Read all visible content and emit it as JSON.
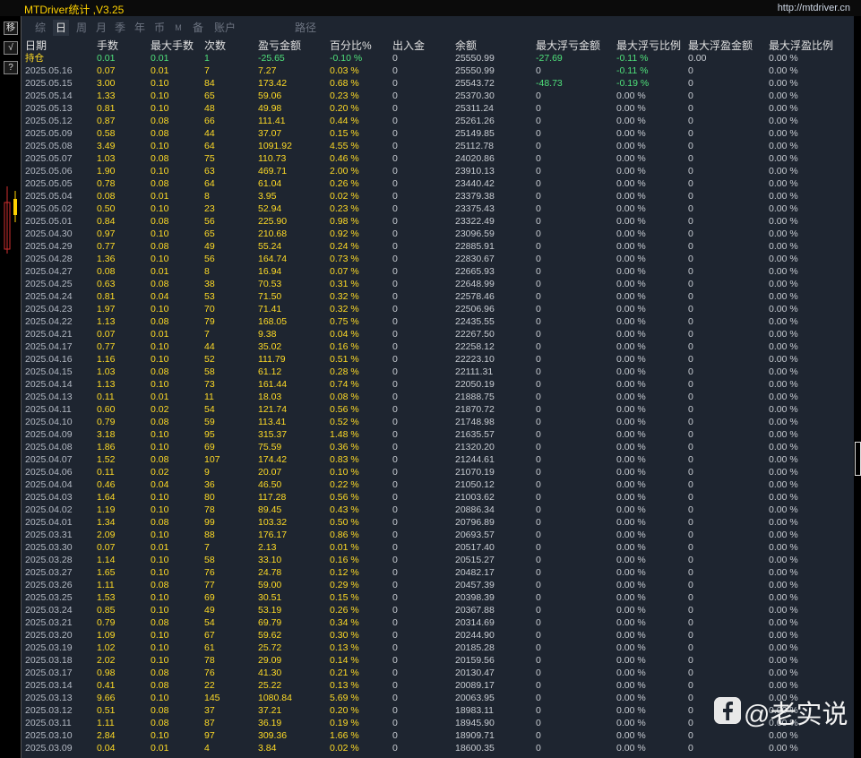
{
  "window": {
    "title": "MTDriver统计 ,V3.25",
    "link": "http://mtdriver.cn"
  },
  "side_toolbar": [
    "移",
    "√",
    "?"
  ],
  "tabs": [
    "综",
    "日",
    "周",
    "月",
    "季",
    "年",
    "币",
    "M",
    "备",
    "账户",
    "路径"
  ],
  "active_tab": "日",
  "table": {
    "headers": [
      "日期",
      "手数",
      "最大手数",
      "次数",
      "盈亏金额",
      "百分比%",
      "出入金",
      "余额",
      "最大浮亏金额",
      "最大浮亏比例",
      "最大浮盈金额",
      "最大浮盈比例"
    ],
    "rows": [
      [
        "持仓",
        "0.01",
        "0.01",
        "1",
        "-25.65",
        "-0.10 %",
        "0",
        "25550.99",
        "-27.69",
        "-0.11 %",
        "0.00",
        "0.00 %"
      ],
      [
        "2025.05.16",
        "0.07",
        "0.01",
        "7",
        "7.27",
        "0.03 %",
        "0",
        "25550.99",
        "0",
        "-0.11 %",
        "0",
        "0.00 %"
      ],
      [
        "2025.05.15",
        "3.00",
        "0.10",
        "84",
        "173.42",
        "0.68 %",
        "0",
        "25543.72",
        "-48.73",
        "-0.19 %",
        "0",
        "0.00 %"
      ],
      [
        "2025.05.14",
        "1.33",
        "0.10",
        "65",
        "59.06",
        "0.23 %",
        "0",
        "25370.30",
        "0",
        "0.00 %",
        "0",
        "0.00 %"
      ],
      [
        "2025.05.13",
        "0.81",
        "0.10",
        "48",
        "49.98",
        "0.20 %",
        "0",
        "25311.24",
        "0",
        "0.00 %",
        "0",
        "0.00 %"
      ],
      [
        "2025.05.12",
        "0.87",
        "0.08",
        "66",
        "111.41",
        "0.44 %",
        "0",
        "25261.26",
        "0",
        "0.00 %",
        "0",
        "0.00 %"
      ],
      [
        "2025.05.09",
        "0.58",
        "0.08",
        "44",
        "37.07",
        "0.15 %",
        "0",
        "25149.85",
        "0",
        "0.00 %",
        "0",
        "0.00 %"
      ],
      [
        "2025.05.08",
        "3.49",
        "0.10",
        "64",
        "1091.92",
        "4.55 %",
        "0",
        "25112.78",
        "0",
        "0.00 %",
        "0",
        "0.00 %"
      ],
      [
        "2025.05.07",
        "1.03",
        "0.08",
        "75",
        "110.73",
        "0.46 %",
        "0",
        "24020.86",
        "0",
        "0.00 %",
        "0",
        "0.00 %"
      ],
      [
        "2025.05.06",
        "1.90",
        "0.10",
        "63",
        "469.71",
        "2.00 %",
        "0",
        "23910.13",
        "0",
        "0.00 %",
        "0",
        "0.00 %"
      ],
      [
        "2025.05.05",
        "0.78",
        "0.08",
        "64",
        "61.04",
        "0.26 %",
        "0",
        "23440.42",
        "0",
        "0.00 %",
        "0",
        "0.00 %"
      ],
      [
        "2025.05.04",
        "0.08",
        "0.01",
        "8",
        "3.95",
        "0.02 %",
        "0",
        "23379.38",
        "0",
        "0.00 %",
        "0",
        "0.00 %"
      ],
      [
        "2025.05.02",
        "0.50",
        "0.10",
        "23",
        "52.94",
        "0.23 %",
        "0",
        "23375.43",
        "0",
        "0.00 %",
        "0",
        "0.00 %"
      ],
      [
        "2025.05.01",
        "0.84",
        "0.08",
        "56",
        "225.90",
        "0.98 %",
        "0",
        "23322.49",
        "0",
        "0.00 %",
        "0",
        "0.00 %"
      ],
      [
        "2025.04.30",
        "0.97",
        "0.10",
        "65",
        "210.68",
        "0.92 %",
        "0",
        "23096.59",
        "0",
        "0.00 %",
        "0",
        "0.00 %"
      ],
      [
        "2025.04.29",
        "0.77",
        "0.08",
        "49",
        "55.24",
        "0.24 %",
        "0",
        "22885.91",
        "0",
        "0.00 %",
        "0",
        "0.00 %"
      ],
      [
        "2025.04.28",
        "1.36",
        "0.10",
        "56",
        "164.74",
        "0.73 %",
        "0",
        "22830.67",
        "0",
        "0.00 %",
        "0",
        "0.00 %"
      ],
      [
        "2025.04.27",
        "0.08",
        "0.01",
        "8",
        "16.94",
        "0.07 %",
        "0",
        "22665.93",
        "0",
        "0.00 %",
        "0",
        "0.00 %"
      ],
      [
        "2025.04.25",
        "0.63",
        "0.08",
        "38",
        "70.53",
        "0.31 %",
        "0",
        "22648.99",
        "0",
        "0.00 %",
        "0",
        "0.00 %"
      ],
      [
        "2025.04.24",
        "0.81",
        "0.04",
        "53",
        "71.50",
        "0.32 %",
        "0",
        "22578.46",
        "0",
        "0.00 %",
        "0",
        "0.00 %"
      ],
      [
        "2025.04.23",
        "1.97",
        "0.10",
        "70",
        "71.41",
        "0.32 %",
        "0",
        "22506.96",
        "0",
        "0.00 %",
        "0",
        "0.00 %"
      ],
      [
        "2025.04.22",
        "1.13",
        "0.08",
        "79",
        "168.05",
        "0.75 %",
        "0",
        "22435.55",
        "0",
        "0.00 %",
        "0",
        "0.00 %"
      ],
      [
        "2025.04.21",
        "0.07",
        "0.01",
        "7",
        "9.38",
        "0.04 %",
        "0",
        "22267.50",
        "0",
        "0.00 %",
        "0",
        "0.00 %"
      ],
      [
        "2025.04.17",
        "0.77",
        "0.10",
        "44",
        "35.02",
        "0.16 %",
        "0",
        "22258.12",
        "0",
        "0.00 %",
        "0",
        "0.00 %"
      ],
      [
        "2025.04.16",
        "1.16",
        "0.10",
        "52",
        "111.79",
        "0.51 %",
        "0",
        "22223.10",
        "0",
        "0.00 %",
        "0",
        "0.00 %"
      ],
      [
        "2025.04.15",
        "1.03",
        "0.08",
        "58",
        "61.12",
        "0.28 %",
        "0",
        "22111.31",
        "0",
        "0.00 %",
        "0",
        "0.00 %"
      ],
      [
        "2025.04.14",
        "1.13",
        "0.10",
        "73",
        "161.44",
        "0.74 %",
        "0",
        "22050.19",
        "0",
        "0.00 %",
        "0",
        "0.00 %"
      ],
      [
        "2025.04.13",
        "0.11",
        "0.01",
        "11",
        "18.03",
        "0.08 %",
        "0",
        "21888.75",
        "0",
        "0.00 %",
        "0",
        "0.00 %"
      ],
      [
        "2025.04.11",
        "0.60",
        "0.02",
        "54",
        "121.74",
        "0.56 %",
        "0",
        "21870.72",
        "0",
        "0.00 %",
        "0",
        "0.00 %"
      ],
      [
        "2025.04.10",
        "0.79",
        "0.08",
        "59",
        "113.41",
        "0.52 %",
        "0",
        "21748.98",
        "0",
        "0.00 %",
        "0",
        "0.00 %"
      ],
      [
        "2025.04.09",
        "3.18",
        "0.10",
        "95",
        "315.37",
        "1.48 %",
        "0",
        "21635.57",
        "0",
        "0.00 %",
        "0",
        "0.00 %"
      ],
      [
        "2025.04.08",
        "1.86",
        "0.10",
        "69",
        "75.59",
        "0.36 %",
        "0",
        "21320.20",
        "0",
        "0.00 %",
        "0",
        "0.00 %"
      ],
      [
        "2025.04.07",
        "1.52",
        "0.08",
        "107",
        "174.42",
        "0.83 %",
        "0",
        "21244.61",
        "0",
        "0.00 %",
        "0",
        "0.00 %"
      ],
      [
        "2025.04.06",
        "0.11",
        "0.02",
        "9",
        "20.07",
        "0.10 %",
        "0",
        "21070.19",
        "0",
        "0.00 %",
        "0",
        "0.00 %"
      ],
      [
        "2025.04.04",
        "0.46",
        "0.04",
        "36",
        "46.50",
        "0.22 %",
        "0",
        "21050.12",
        "0",
        "0.00 %",
        "0",
        "0.00 %"
      ],
      [
        "2025.04.03",
        "1.64",
        "0.10",
        "80",
        "117.28",
        "0.56 %",
        "0",
        "21003.62",
        "0",
        "0.00 %",
        "0",
        "0.00 %"
      ],
      [
        "2025.04.02",
        "1.19",
        "0.10",
        "78",
        "89.45",
        "0.43 %",
        "0",
        "20886.34",
        "0",
        "0.00 %",
        "0",
        "0.00 %"
      ],
      [
        "2025.04.01",
        "1.34",
        "0.08",
        "99",
        "103.32",
        "0.50 %",
        "0",
        "20796.89",
        "0",
        "0.00 %",
        "0",
        "0.00 %"
      ],
      [
        "2025.03.31",
        "2.09",
        "0.10",
        "88",
        "176.17",
        "0.86 %",
        "0",
        "20693.57",
        "0",
        "0.00 %",
        "0",
        "0.00 %"
      ],
      [
        "2025.03.30",
        "0.07",
        "0.01",
        "7",
        "2.13",
        "0.01 %",
        "0",
        "20517.40",
        "0",
        "0.00 %",
        "0",
        "0.00 %"
      ],
      [
        "2025.03.28",
        "1.14",
        "0.10",
        "58",
        "33.10",
        "0.16 %",
        "0",
        "20515.27",
        "0",
        "0.00 %",
        "0",
        "0.00 %"
      ],
      [
        "2025.03.27",
        "1.65",
        "0.10",
        "76",
        "24.78",
        "0.12 %",
        "0",
        "20482.17",
        "0",
        "0.00 %",
        "0",
        "0.00 %"
      ],
      [
        "2025.03.26",
        "1.11",
        "0.08",
        "77",
        "59.00",
        "0.29 %",
        "0",
        "20457.39",
        "0",
        "0.00 %",
        "0",
        "0.00 %"
      ],
      [
        "2025.03.25",
        "1.53",
        "0.10",
        "69",
        "30.51",
        "0.15 %",
        "0",
        "20398.39",
        "0",
        "0.00 %",
        "0",
        "0.00 %"
      ],
      [
        "2025.03.24",
        "0.85",
        "0.10",
        "49",
        "53.19",
        "0.26 %",
        "0",
        "20367.88",
        "0",
        "0.00 %",
        "0",
        "0.00 %"
      ],
      [
        "2025.03.21",
        "0.79",
        "0.08",
        "54",
        "69.79",
        "0.34 %",
        "0",
        "20314.69",
        "0",
        "0.00 %",
        "0",
        "0.00 %"
      ],
      [
        "2025.03.20",
        "1.09",
        "0.10",
        "67",
        "59.62",
        "0.30 %",
        "0",
        "20244.90",
        "0",
        "0.00 %",
        "0",
        "0.00 %"
      ],
      [
        "2025.03.19",
        "1.02",
        "0.10",
        "61",
        "25.72",
        "0.13 %",
        "0",
        "20185.28",
        "0",
        "0.00 %",
        "0",
        "0.00 %"
      ],
      [
        "2025.03.18",
        "2.02",
        "0.10",
        "78",
        "29.09",
        "0.14 %",
        "0",
        "20159.56",
        "0",
        "0.00 %",
        "0",
        "0.00 %"
      ],
      [
        "2025.03.17",
        "0.98",
        "0.08",
        "76",
        "41.30",
        "0.21 %",
        "0",
        "20130.47",
        "0",
        "0.00 %",
        "0",
        "0.00 %"
      ],
      [
        "2025.03.14",
        "0.41",
        "0.08",
        "22",
        "25.22",
        "0.13 %",
        "0",
        "20089.17",
        "0",
        "0.00 %",
        "0",
        "0.00 %"
      ],
      [
        "2025.03.13",
        "9.66",
        "0.10",
        "145",
        "1080.84",
        "5.69 %",
        "0",
        "20063.95",
        "0",
        "0.00 %",
        "0",
        "0.00 %"
      ],
      [
        "2025.03.12",
        "0.51",
        "0.08",
        "37",
        "37.21",
        "0.20 %",
        "0",
        "18983.11",
        "0",
        "0.00 %",
        "0",
        "0.00 %"
      ],
      [
        "2025.03.11",
        "1.11",
        "0.08",
        "87",
        "36.19",
        "0.19 %",
        "0",
        "18945.90",
        "0",
        "0.00 %",
        "0",
        "0.00 %"
      ],
      [
        "2025.03.10",
        "2.84",
        "0.10",
        "97",
        "309.36",
        "1.66 %",
        "0",
        "18909.71",
        "0",
        "0.00 %",
        "0",
        "0.00 %"
      ],
      [
        "2025.03.09",
        "0.04",
        "0.01",
        "4",
        "3.84",
        "0.02 %",
        "0",
        "18600.35",
        "0",
        "0.00 %",
        "0",
        "0.00 %"
      ]
    ]
  },
  "colors": {
    "panel_bg": "#1e2530",
    "title": "#ffd200",
    "value_yellow": "#ffdb26",
    "value_green": "#4fe07a",
    "value_white": "#c8ccd2",
    "date": "#b4bac4"
  },
  "watermark": {
    "icon": "facebook-logo-icon",
    "text": "@老实说"
  }
}
